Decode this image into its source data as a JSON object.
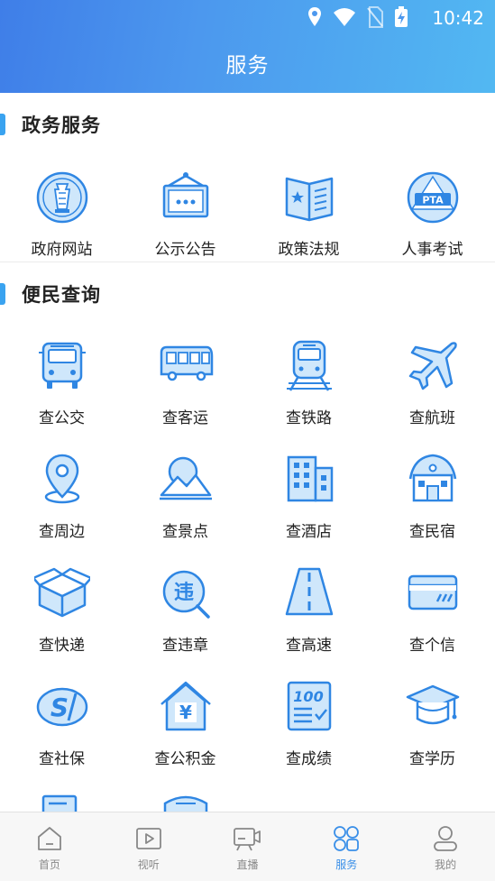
{
  "status": {
    "time": "10:42"
  },
  "header": {
    "title": "服务"
  },
  "sections": [
    {
      "title": "政务服务",
      "items": [
        {
          "label": "政府网站",
          "icon": "emblem-icon"
        },
        {
          "label": "公示公告",
          "icon": "notice-board-icon"
        },
        {
          "label": "政策法规",
          "icon": "book-icon"
        },
        {
          "label": "人事考试",
          "icon": "pta-icon"
        }
      ]
    },
    {
      "title": "便民查询",
      "items": [
        {
          "label": "查公交",
          "icon": "bus-icon"
        },
        {
          "label": "查客运",
          "icon": "coach-icon"
        },
        {
          "label": "查铁路",
          "icon": "train-icon"
        },
        {
          "label": "查航班",
          "icon": "airplane-icon"
        },
        {
          "label": "查周边",
          "icon": "location-pin-icon"
        },
        {
          "label": "查景点",
          "icon": "landscape-icon"
        },
        {
          "label": "查酒店",
          "icon": "hotel-icon"
        },
        {
          "label": "查民宿",
          "icon": "house-icon"
        },
        {
          "label": "查快递",
          "icon": "package-icon"
        },
        {
          "label": "查违章",
          "icon": "violation-icon"
        },
        {
          "label": "查高速",
          "icon": "highway-icon"
        },
        {
          "label": "查个信",
          "icon": "credit-card-icon"
        },
        {
          "label": "查社保",
          "icon": "social-security-icon"
        },
        {
          "label": "查公积金",
          "icon": "housing-fund-icon"
        },
        {
          "label": "查成绩",
          "icon": "score-icon"
        },
        {
          "label": "查学历",
          "icon": "graduation-cap-icon"
        }
      ]
    }
  ],
  "tabs": [
    {
      "label": "首页",
      "icon": "home-icon",
      "active": false
    },
    {
      "label": "视听",
      "icon": "play-icon",
      "active": false
    },
    {
      "label": "直播",
      "icon": "video-camera-icon",
      "active": false
    },
    {
      "label": "服务",
      "icon": "grid-icon",
      "active": true
    },
    {
      "label": "我的",
      "icon": "user-icon",
      "active": false
    }
  ],
  "colors": {
    "accent": "#3a8fe8",
    "icon_fill": "#cfe7fb",
    "icon_stroke": "#2f86e3"
  }
}
